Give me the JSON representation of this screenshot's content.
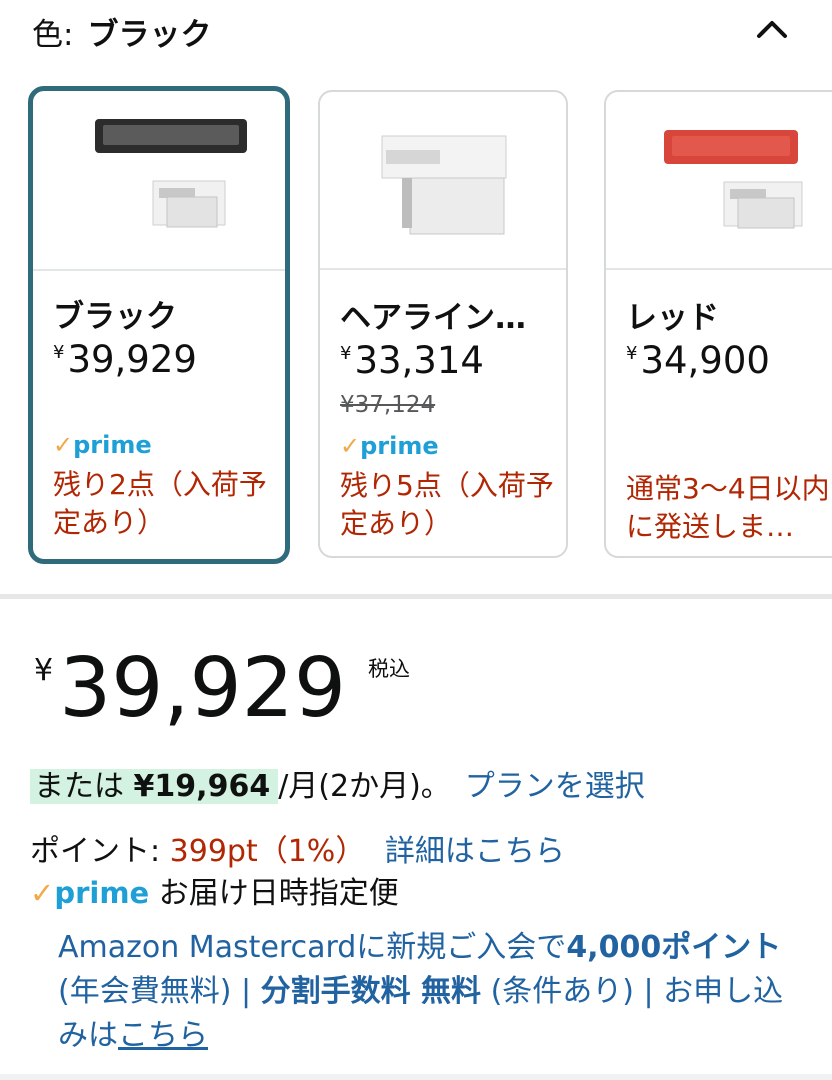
{
  "color_selector": {
    "label": "色:",
    "selected_value": "ブラック",
    "collapse_icon": "chevron-up-icon"
  },
  "swatches": [
    {
      "name": "ブラック",
      "price_currency": "¥",
      "price": "39,929",
      "prime": "prime",
      "stock": "残り2点（入荷予定あり）",
      "selected": true
    },
    {
      "name": "ヘアライン…",
      "price_currency": "¥",
      "price": "33,314",
      "list_price": "¥37,124",
      "prime": "prime",
      "stock": "残り5点（入荷予定あり）"
    },
    {
      "name": "レッド",
      "price_currency": "¥",
      "price": "34,900",
      "stock": "通常3〜4日以内に発送しま…"
    }
  ],
  "price_block": {
    "currency": "¥",
    "amount": "39,929",
    "tax_note": "税込"
  },
  "installment": {
    "prefix": "または",
    "amount": "¥19,964",
    "period": "/月(2か月)。",
    "plan_link": "プランを選択"
  },
  "points": {
    "label": "ポイント:",
    "value": "399pt（1%）",
    "details_link": "詳細はこちら"
  },
  "delivery": {
    "prime": "prime",
    "text": "お届け日時指定便"
  },
  "promo": {
    "part1": "Amazon Mastercardに新規ご入会で",
    "points_bold": "4,000ポイント",
    "part2": " (年会費無料) | ",
    "fee_bold": "分割手数料 無料",
    "part3": " (条件あり) | お申し込みは",
    "link": "こちら"
  },
  "colors": {
    "accent_border": "#2f6b7b",
    "link": "#2162a1",
    "deal_red": "#b12704",
    "prime_blue": "#1ea0d7",
    "prime_check": "#f3a847",
    "installment_highlight": "#d4f2e1"
  }
}
